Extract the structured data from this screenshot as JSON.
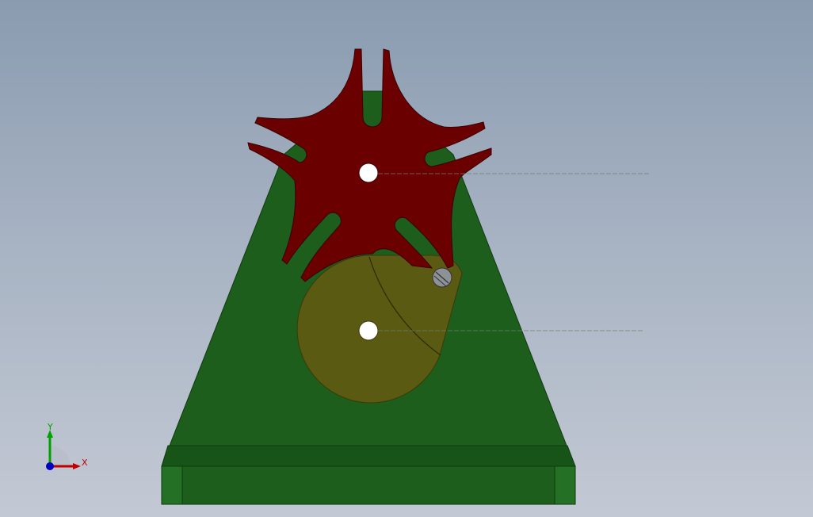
{
  "viewport": {
    "background_top": "#8a9bb0",
    "background_bottom": "#c3c9d4"
  },
  "colors": {
    "base_green": "#1d5e1c",
    "base_green_dark": "#144a14",
    "base_green_edge": "#0f3a0f",
    "geneva_wheel": "#6b0000",
    "geneva_edge": "#3a0000",
    "drive_disc": "#5a5a12",
    "drive_disc_edge": "#3a3a08",
    "pin_gray": "#8d9296",
    "axis_x": "#c00000",
    "axis_y": "#00a000",
    "axis_z": "#0000c0"
  },
  "triad": {
    "x_label": "X",
    "y_label": "Y"
  },
  "icons": {
    "coordinate_triad": "axis-triad-icon",
    "pin": "pin-icon"
  }
}
